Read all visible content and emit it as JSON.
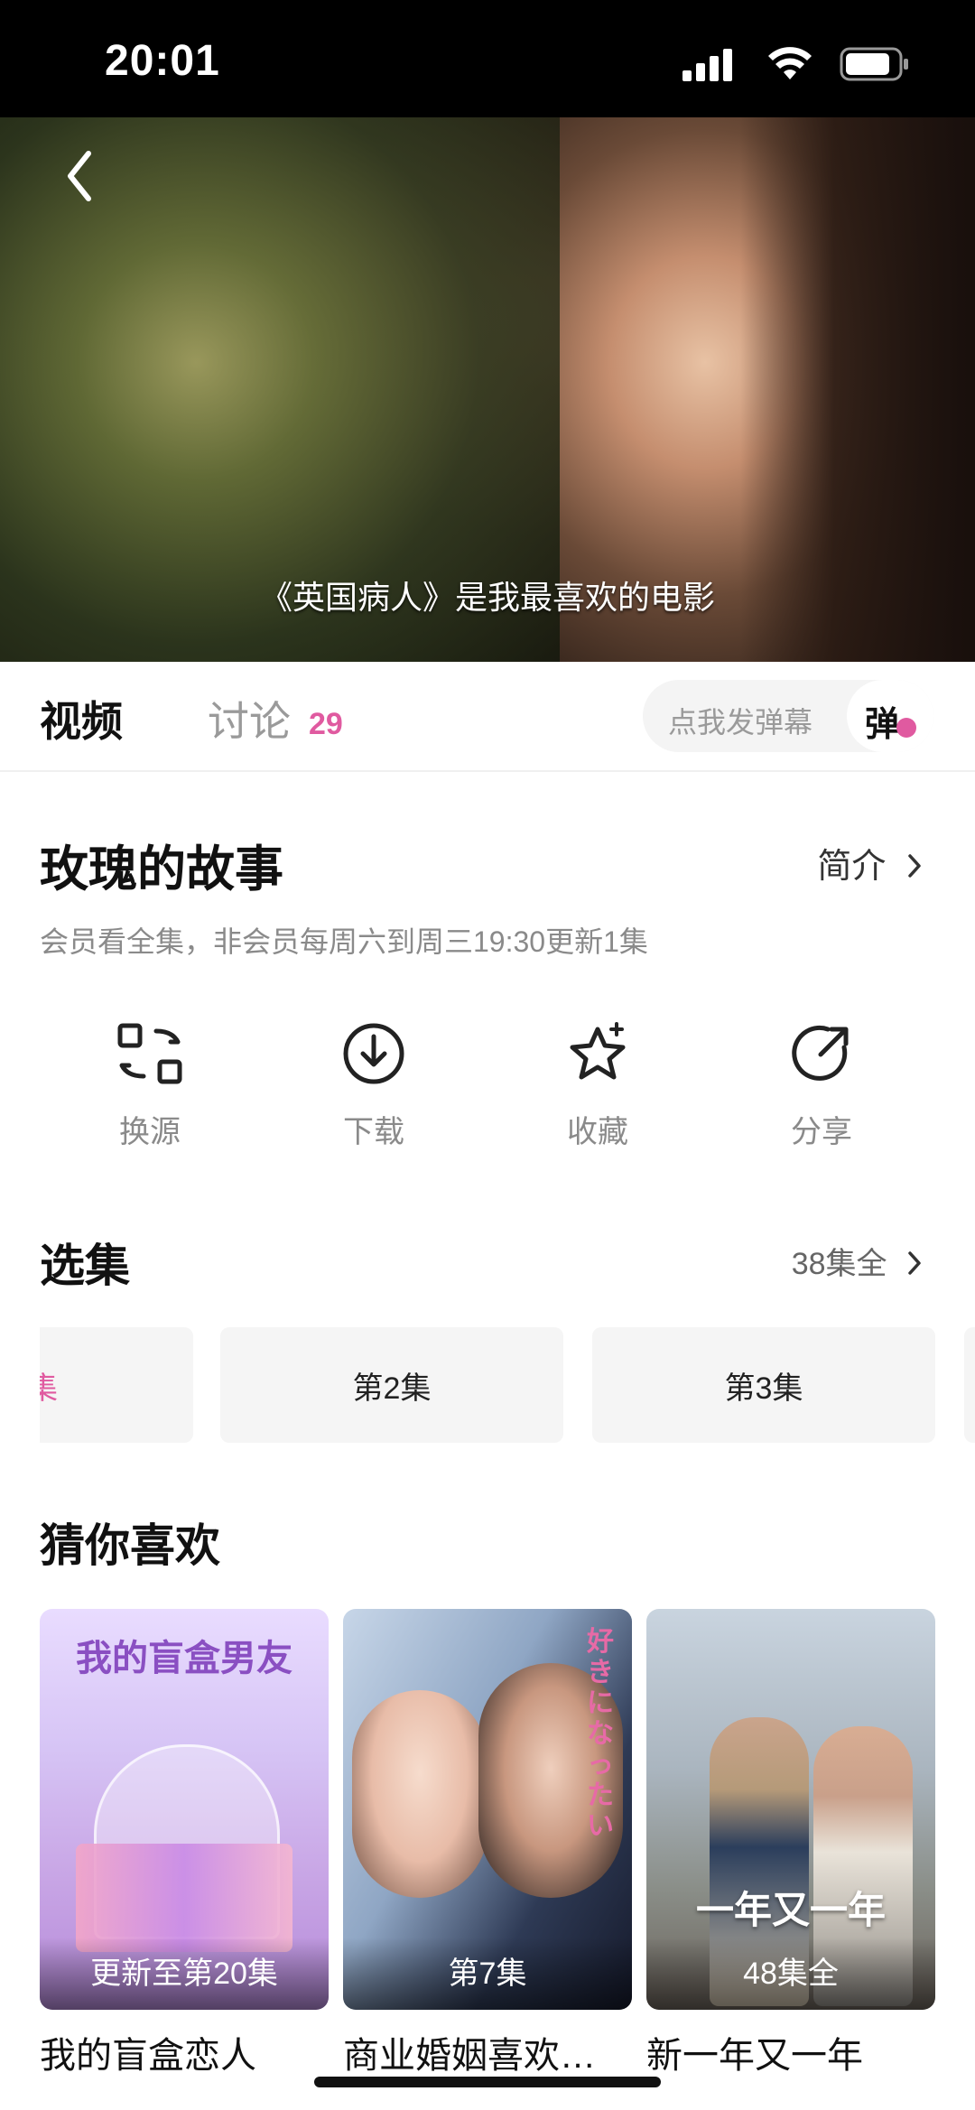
{
  "status_bar": {
    "time": "20:01"
  },
  "video": {
    "subtitle": "《英国病人》是我最喜欢的电影"
  },
  "tabs": {
    "video_label": "视频",
    "discuss_label": "讨论",
    "discuss_count": "29"
  },
  "danmaku": {
    "placeholder": "点我发弹幕",
    "button_char": "弹"
  },
  "show": {
    "title": "玫瑰的故事",
    "intro_label": "简介",
    "info": "会员看全集，非会员每周六到周三19:30更新1集"
  },
  "actions": [
    {
      "label": "换源",
      "icon": "switch-source-icon"
    },
    {
      "label": "下载",
      "icon": "download-icon"
    },
    {
      "label": "收藏",
      "icon": "favorite-star-icon"
    },
    {
      "label": "分享",
      "icon": "share-icon"
    }
  ],
  "episodes_section": {
    "title": "选集",
    "more_label": "38集全",
    "items": [
      {
        "label": "集"
      },
      {
        "label": "第2集"
      },
      {
        "label": "第3集"
      }
    ]
  },
  "recommend_section": {
    "title": "猜你喜欢",
    "items": [
      {
        "title": "我的盲盒恋人",
        "caption": "更新至第20集",
        "poster_text": "我的盲盒男友"
      },
      {
        "title": "商业婚姻喜欢…",
        "caption": "第7集",
        "poster_text": "好きになったい"
      },
      {
        "title": "新一年又一年",
        "caption": "48集全",
        "poster_text": "一年又一年"
      }
    ]
  },
  "colors": {
    "accent": "#e05aa0"
  }
}
